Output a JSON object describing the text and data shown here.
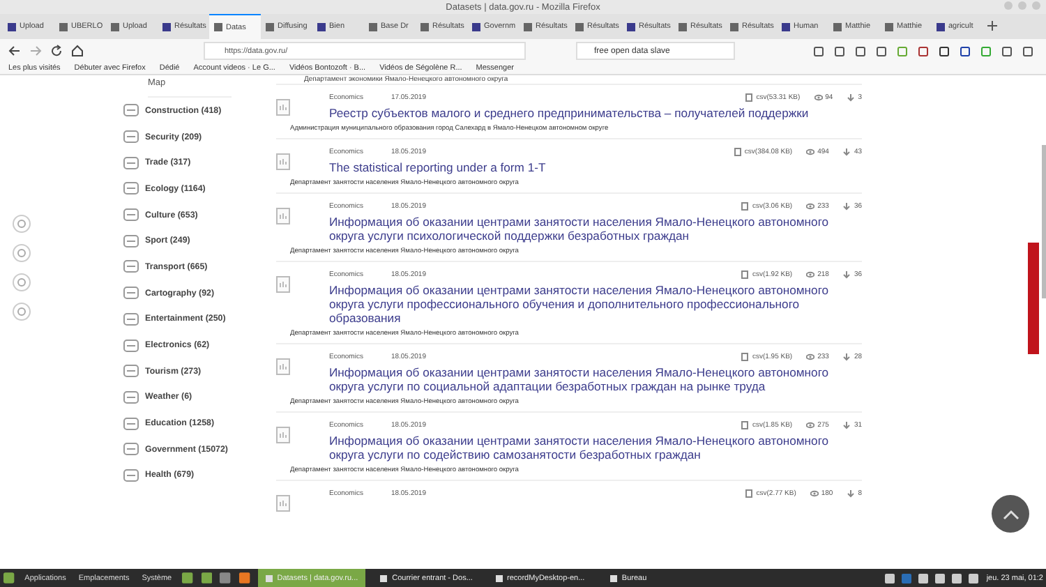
{
  "window": {
    "title": "Datasets | data.gov.ru - Mozilla Firefox"
  },
  "tabs": [
    {
      "label": "Upload",
      "selected": false
    },
    {
      "label": "UBERLO",
      "selected": false
    },
    {
      "label": "Upload",
      "selected": false
    },
    {
      "label": "Résultats",
      "selected": false
    },
    {
      "label": "Datas",
      "selected": true
    },
    {
      "label": "Diffusing",
      "selected": false
    },
    {
      "label": "Bien",
      "selected": false
    },
    {
      "label": "Base Dr",
      "selected": false
    },
    {
      "label": "Résultats",
      "selected": false
    },
    {
      "label": "Governm",
      "selected": false
    },
    {
      "label": "Résultats",
      "selected": false
    },
    {
      "label": "Résultats",
      "selected": false
    },
    {
      "label": "Résultats",
      "selected": false
    },
    {
      "label": "Résultats",
      "selected": false
    },
    {
      "label": "Résultats",
      "selected": false
    },
    {
      "label": "Human",
      "selected": false
    },
    {
      "label": "Matthie",
      "selected": false
    },
    {
      "label": "Matthie",
      "selected": false
    },
    {
      "label": "agricult",
      "selected": false
    }
  ],
  "address_bar": {
    "url": "https://data.gov.ru/"
  },
  "search": {
    "value": "free open data slave"
  },
  "bookmarks": [
    "Les plus visités",
    "Débuter avec Firefox",
    "Dédié",
    "Account videos · Le G...",
    "Vidéos Bontozoft · B...",
    "Vidéos de Ségolène R...",
    "Messenger"
  ],
  "page": {
    "top_text": "Департамент экономики Ямало-Ненецкого автономного округа",
    "map_link": "Map",
    "categories": [
      "Construction (418)",
      "Security (209)",
      "Trade (317)",
      "Ecology (1164)",
      "Culture (653)",
      "Sport (249)",
      "Transport (665)",
      "Cartography (92)",
      "Entertainment (250)",
      "Electronics (62)",
      "Tourism (273)",
      "Weather (6)",
      "Education (1258)",
      "Government (15072)",
      "Health (679)"
    ],
    "datasets": [
      {
        "category": "Economics",
        "date": "17.05.2019",
        "title": "Реестр субъектов малого и среднего предпринимательства – получателей поддержки",
        "org": "Администрация муниципального образования город Салехард в Ямало-Ненецком автономном округе",
        "file": "csv(53.31 KB)",
        "views": "94",
        "downloads": "3"
      },
      {
        "category": "Economics",
        "date": "18.05.2019",
        "title": "The statistical reporting under a form 1-T",
        "org": "Департамент занятости населения Ямало-Ненецкого автономного округа",
        "file": "csv(384.08 KB)",
        "views": "494",
        "downloads": "43"
      },
      {
        "category": "Economics",
        "date": "18.05.2019",
        "title": "Информация об оказании центрами занятости населения Ямало-Ненецкого автономного округа услуги психологической поддержки безработных граждан",
        "org": "Департамент занятости населения Ямало-Ненецкого автономного округа",
        "file": "csv(3.06 KB)",
        "views": "233",
        "downloads": "36"
      },
      {
        "category": "Economics",
        "date": "18.05.2019",
        "title": "Информация об оказании центрами занятости населения Ямало-Ненецкого автономного округа услуги профессионального обучения и дополнительного профессионального образования",
        "org": "Департамент занятости населения Ямало-Ненецкого автономного округа",
        "file": "csv(1.92 KB)",
        "views": "218",
        "downloads": "36"
      },
      {
        "category": "Economics",
        "date": "18.05.2019",
        "title": "Информация об оказании центрами занятости населения Ямало-Ненецкого автономного округа услуги по социальной адаптации безработных граждан на рынке труда",
        "org": "Департамент занятости населения Ямало-Ненецкого автономного округа",
        "file": "csv(1.95 KB)",
        "views": "233",
        "downloads": "28"
      },
      {
        "category": "Economics",
        "date": "18.05.2019",
        "title": "Информация об оказании центрами занятости населения Ямало-Ненецкого автономного округа услуги по содействию самозанятости безработных граждан",
        "org": "Департамент занятости населения Ямало-Ненецкого автономного округа",
        "file": "csv(1.85 KB)",
        "views": "275",
        "downloads": "31"
      },
      {
        "category": "Economics",
        "date": "18.05.2019",
        "file": "csv(2.77 KB)",
        "views": "180",
        "downloads": "8"
      }
    ]
  },
  "taskbar": {
    "menus": [
      "Applications",
      "Emplacements",
      "Système"
    ],
    "tasks": [
      {
        "label": "Datasets | data.gov.ru...",
        "selected": true
      },
      {
        "label": "Courrier entrant - Dos...",
        "selected": false
      },
      {
        "label": "recordMyDesktop-en...",
        "selected": false
      },
      {
        "label": "Bureau",
        "selected": false
      }
    ],
    "clock": "jeu. 23 mai, 01:2"
  }
}
